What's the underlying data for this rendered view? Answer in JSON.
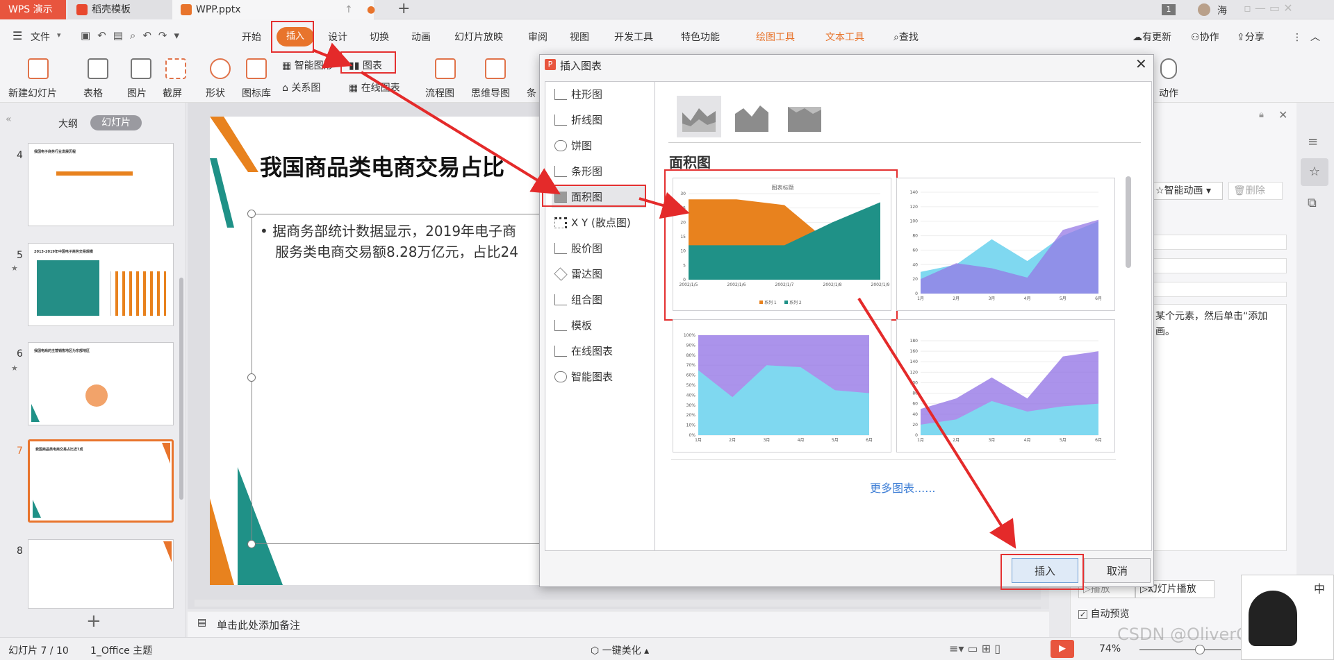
{
  "tabs": {
    "app": "WPS 演示",
    "template": "稻壳模板",
    "doc": "WPP.pptx",
    "page_badge": "1",
    "user": "海"
  },
  "menu": {
    "file": "文件",
    "items": [
      "开始",
      "插入",
      "设计",
      "切换",
      "动画",
      "幻灯片放映",
      "审阅",
      "视图",
      "开发工具",
      "特色功能"
    ],
    "drawing_tools": "绘图工具",
    "text_tools": "文本工具",
    "search": "查找",
    "update": "有更新",
    "collab": "协作",
    "share": "分享"
  },
  "ribbon": {
    "new_slide": "新建幻灯片",
    "table": "表格",
    "picture": "图片",
    "screenshot": "截屏",
    "shape": "形状",
    "icon_lib": "图标库",
    "smart_graphic": "智能图形",
    "chart": "图表",
    "relation": "关系图",
    "online_chart": "在线图表",
    "flowchart": "流程图",
    "mindmap": "思维导图",
    "more": "条",
    "action": "动作"
  },
  "leftpanel": {
    "outline": "大纲",
    "slides": "幻灯片",
    "thumbs": [
      {
        "num": "4",
        "title": "我国电子商务行业发展历程"
      },
      {
        "num": "5",
        "title": "2013-2019年中国电子商务交易规模"
      },
      {
        "num": "6",
        "title": "我国电商的主营销售地区为东部地区"
      },
      {
        "num": "7",
        "title": "我国商品类电商交易占比近7成"
      },
      {
        "num": "8",
        "title": ""
      }
    ]
  },
  "slide": {
    "title": "我国商品类电商交易占比",
    "bullet_line1": "据商务部统计数据显示，2019年电子商",
    "bullet_line2": "服务类电商交易额8.28万亿元，占比24"
  },
  "notes": {
    "placeholder": "单击此处添加备注"
  },
  "status": {
    "slide_index": "幻灯片 7 / 10",
    "theme": "1_Office 主题",
    "beautify": "一键美化",
    "zoom": "74%"
  },
  "rightpanel": {
    "smart_anim": "智能动画",
    "delete": "删除",
    "hint_line1": "某个元素，然后单击“添加",
    "hint_line2": "画。",
    "play": "播放",
    "slideshow": "幻灯片播放",
    "auto_preview": "自动预览"
  },
  "dialog": {
    "title": "插入图表",
    "categories": [
      "柱形图",
      "折线图",
      "饼图",
      "条形图",
      "面积图",
      "X Y (散点图)",
      "股价图",
      "雷达图",
      "组合图",
      "模板",
      "在线图表",
      "智能图表"
    ],
    "section_title": "面积图",
    "more_charts": "更多图表......",
    "insert": "插入",
    "cancel": "取消",
    "preview1": {
      "title": "图表标题",
      "yticks": [
        "30",
        "25",
        "20",
        "15",
        "10",
        "5",
        "0"
      ],
      "xticks": [
        "2002/1/5",
        "2002/1/6",
        "2002/1/7",
        "2002/1/8",
        "2002/1/9"
      ],
      "legend": [
        "系列 1",
        "系列 2"
      ],
      "colors": {
        "s1": "#e8821e",
        "s2": "#1f9187"
      }
    },
    "preview2": {
      "yticks": [
        "140",
        "120",
        "100",
        "80",
        "60",
        "40",
        "20",
        "0"
      ],
      "xticks": [
        "1月",
        "2月",
        "3月",
        "4月",
        "5月",
        "6月"
      ]
    },
    "preview3": {
      "yticks": [
        "100%",
        "90%",
        "80%",
        "70%",
        "60%",
        "50%",
        "40%",
        "30%",
        "20%",
        "10%",
        "0%"
      ],
      "xticks": [
        "1月",
        "2月",
        "3月",
        "4月",
        "5月",
        "6月"
      ]
    },
    "preview4": {
      "yticks": [
        "180",
        "160",
        "140",
        "120",
        "100",
        "80",
        "60",
        "40",
        "20",
        "0"
      ],
      "xticks": [
        "1月",
        "2月",
        "3月",
        "4月",
        "5月",
        "6月"
      ]
    }
  },
  "watermark": "CSDN @OliverCorrect",
  "ime": "中"
}
